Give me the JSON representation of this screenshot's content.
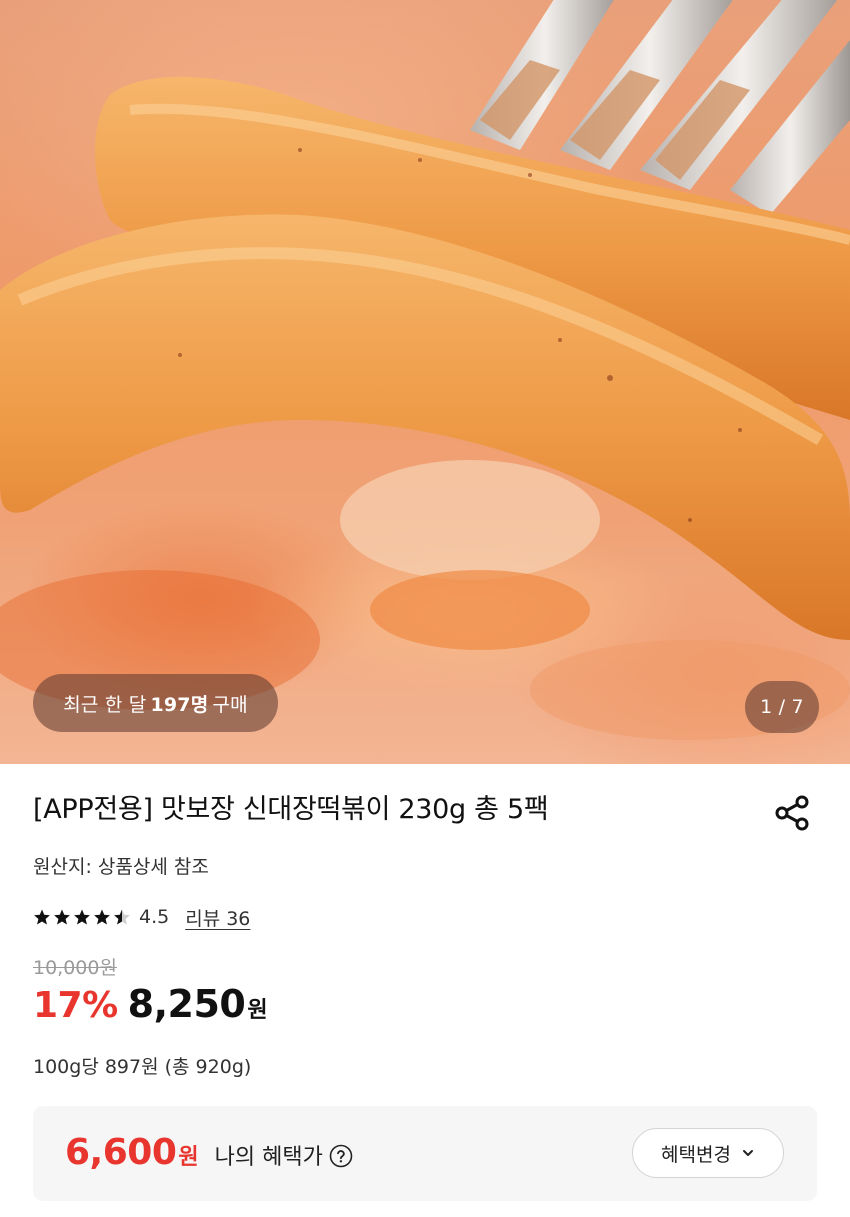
{
  "hero": {
    "buyers_prefix": "최근 한 달",
    "buyers_count": "197명",
    "buyers_suffix": "구매",
    "image_counter": "1 / 7"
  },
  "product": {
    "title": "[APP전용] 맛보장 신대장떡볶이 230g 총 5팩",
    "origin": "원산지: 상품상세 참조",
    "rating": "4.5",
    "rating_value": 4.5,
    "rating_max": 5,
    "review_link": "리뷰 36",
    "original_price": "10,000원",
    "discount": "17%",
    "price": "8,250",
    "price_unit": "원",
    "unit_price": "100g당 897원 (총 920g)"
  },
  "benefit": {
    "price": "6,600",
    "price_unit": "원",
    "label": "나의 혜택가",
    "change_button": "혜택변경"
  },
  "colors": {
    "accent_red": "#e8352e",
    "benefit_bg": "#f6f6f7"
  },
  "icons": {
    "share": "share-icon",
    "help": "question-circle-icon",
    "chevron": "chevron-down-icon",
    "star": "star-icon"
  }
}
